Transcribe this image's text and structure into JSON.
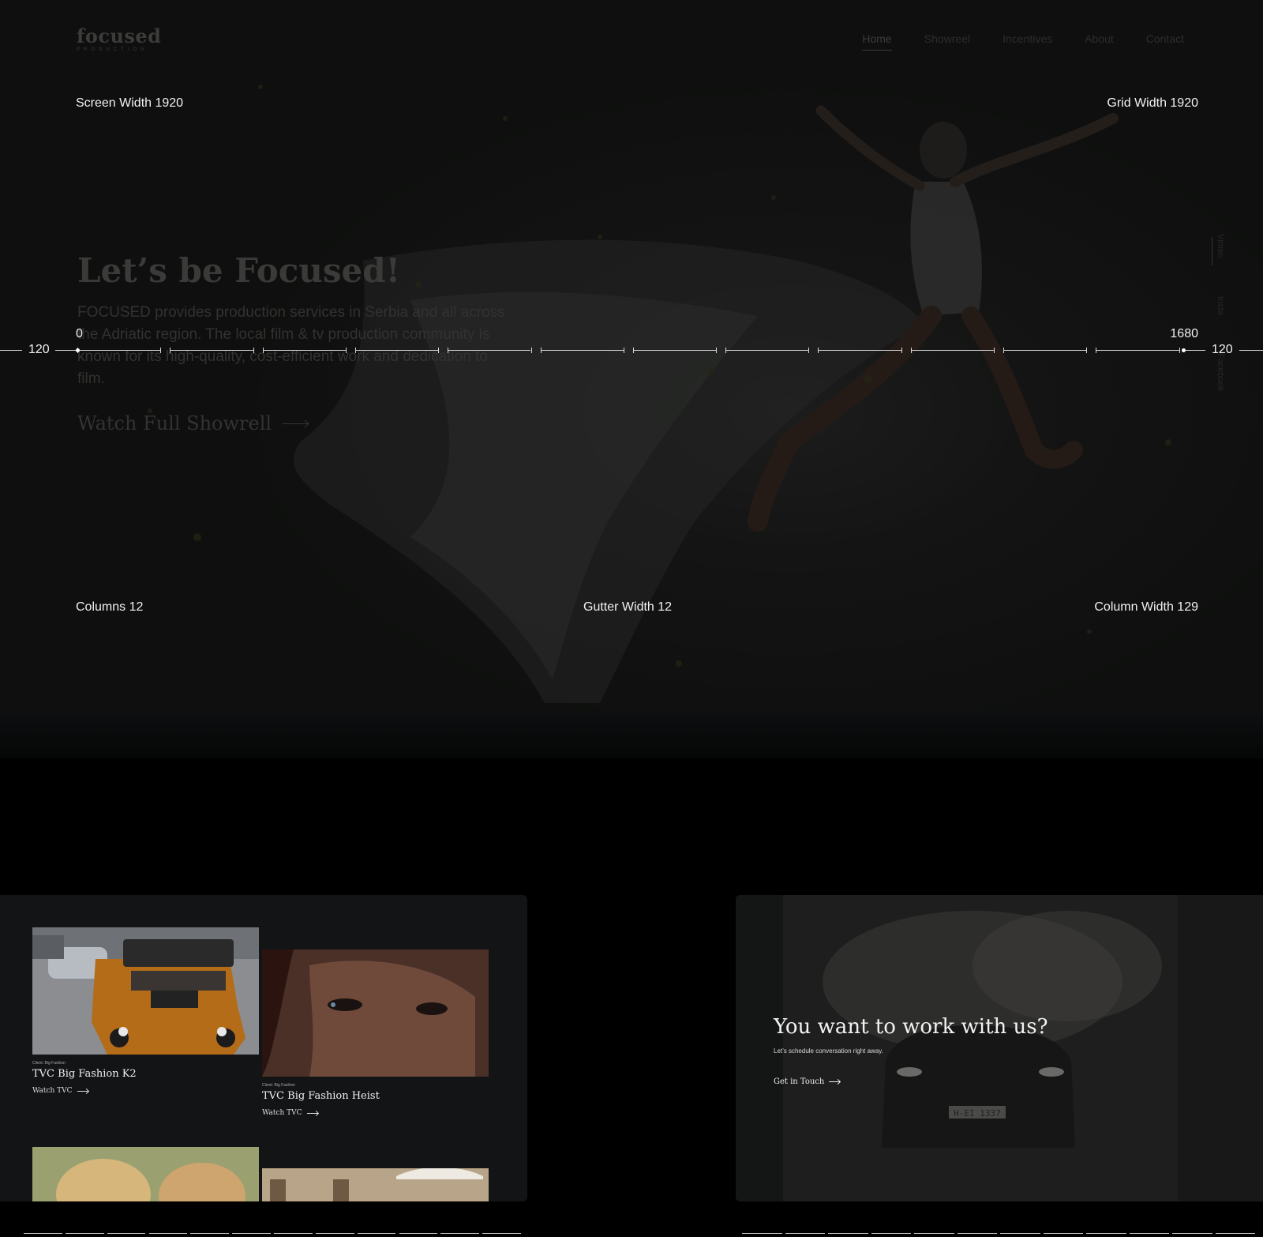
{
  "header": {
    "logo_main": "focused",
    "logo_sub": "PRODUCTION",
    "nav": [
      "Home",
      "Showreel",
      "Incentives",
      "About",
      "Contact"
    ]
  },
  "side_social": [
    "Vimeo",
    "Insta",
    "Facebook"
  ],
  "hero": {
    "title": "Let’s be Focused!",
    "text": "FOCUSED provides production services in Serbia and all across the Adriatic region. The local film & tv production community is known for its high-quality, cost-efficient work and dedication to film.",
    "cta": "Watch Full Showrell"
  },
  "grid_annotations": {
    "screen_width": "Screen Width 1920",
    "grid_width": "Grid Width 1920",
    "margin_left": "120",
    "margin_right": "120",
    "start": "0",
    "end": "1680",
    "columns": "Columns 12",
    "gutter": "Gutter Width 12",
    "column_width": "Column Width 129"
  },
  "projects": [
    {
      "client": "Client: Big Fashion",
      "title": "TVC Big Fashion K2",
      "watch": "Watch TVC"
    },
    {
      "client": "Client: Big Fashion",
      "title": "TVC Big Fashion Heist",
      "watch": "Watch TVC"
    }
  ],
  "contact_cta": {
    "title": "You want to work with us?",
    "subtitle": "Let’s schedule conversation right away.",
    "link": "Get in Touch"
  },
  "colors": {
    "background": "#000000",
    "panel": "#121415",
    "annotation": "#f2f2f2"
  }
}
